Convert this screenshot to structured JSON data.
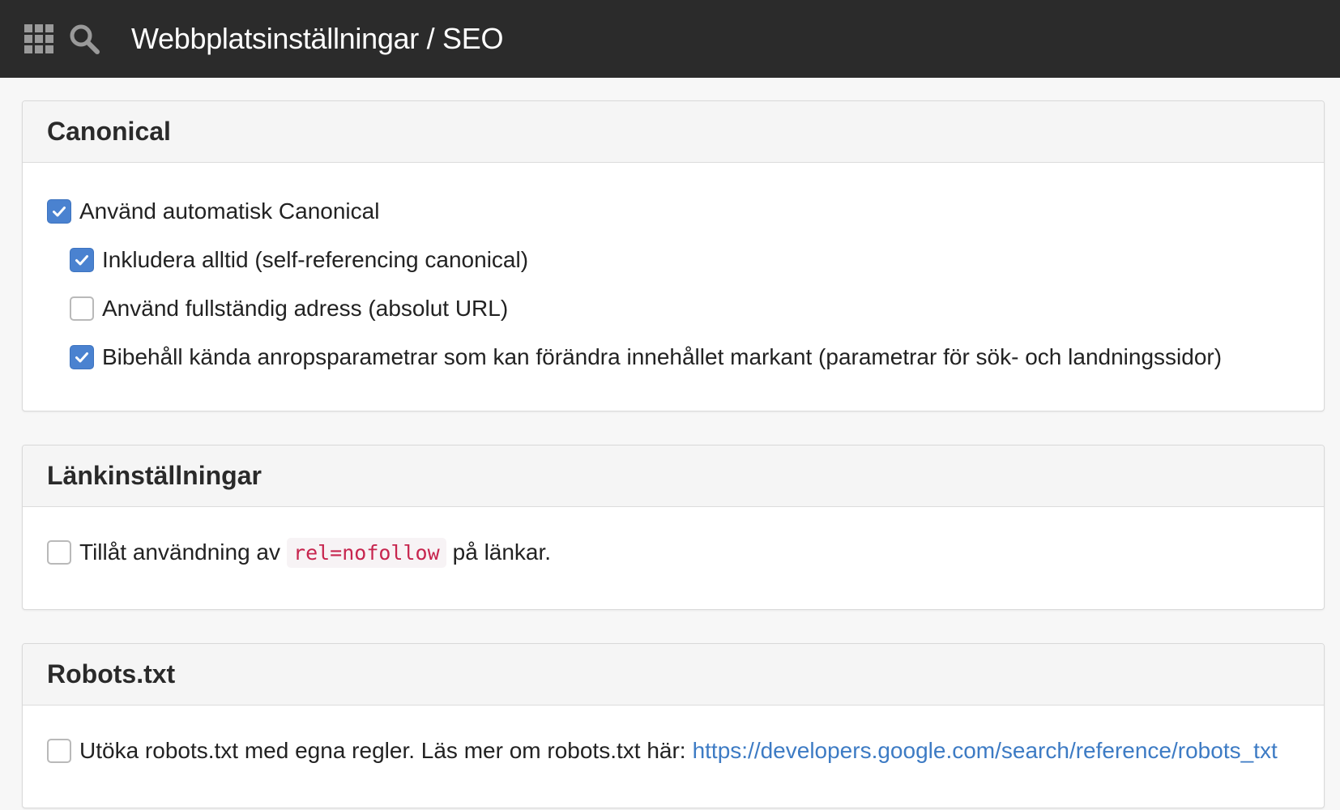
{
  "header": {
    "apps_icon": "apps-grid-icon",
    "search_icon": "search-icon",
    "title": "Webbplatsinställningar / SEO",
    "background": "#2b2b2b"
  },
  "panels": {
    "canonical": {
      "title": "Canonical",
      "options": [
        {
          "label": "Använd automatisk Canonical",
          "checked": true,
          "level": 0
        },
        {
          "label": "Inkludera alltid (self-referencing canonical)",
          "checked": true,
          "level": 1
        },
        {
          "label": "Använd fullständig adress (absolut URL)",
          "checked": false,
          "level": 1
        },
        {
          "label": "Bibehåll kända anropsparametrar som kan förändra innehållet markant (parametrar för sök- och landningssidor)",
          "checked": true,
          "level": 1
        }
      ]
    },
    "links": {
      "title": "Länkinställningar",
      "option": {
        "prefix": "Tillåt användning av",
        "code": "rel=nofollow",
        "suffix": "på länkar.",
        "checked": false
      }
    },
    "robots": {
      "title": "Robots.txt",
      "option": {
        "label": "Utöka robots.txt med egna regler. Läs mer om robots.txt här:",
        "link": "https://developers.google.com/search/reference/robots_txt",
        "checked": false
      }
    }
  },
  "colors": {
    "checkbox_checked": "#4a82d0",
    "link": "#3d7bc4",
    "code_text": "#c7254e"
  }
}
